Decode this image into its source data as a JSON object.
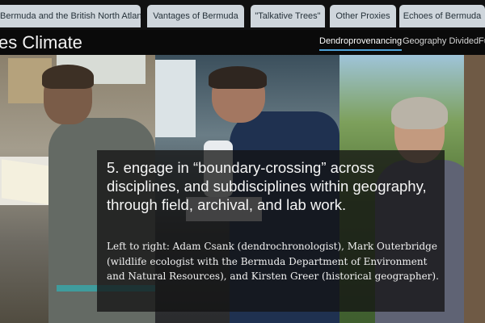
{
  "tabs": [
    {
      "label": "Bermuda and the British North Atlantic"
    },
    {
      "label": "Vantages of Bermuda"
    },
    {
      "label": "\"Talkative Trees\""
    },
    {
      "label": "Other Proxies"
    },
    {
      "label": "Echoes of Bermuda"
    }
  ],
  "header": {
    "title": "es Climate",
    "sections": [
      {
        "label": "Dendroprovenancing",
        "active": true
      },
      {
        "label": "Geography Divided"
      },
      {
        "label": "Fu"
      }
    ]
  },
  "caption": {
    "heading": "5. engage in “boundary-crossing” across disciplines, and subdisciplines within geography, through field, archival, and lab work.",
    "credit": "Left to right: Adam Csank (dendrochronologist), Mark Outerbridge (wildlife ecologist with the Bermuda Department of Environment and Natural Resources), and Kirsten Greer (historical geographer)."
  },
  "colors": {
    "accent": "#4fa3d9",
    "tab_background": "#cfd6dc",
    "header_background": "#0a0a0a"
  }
}
